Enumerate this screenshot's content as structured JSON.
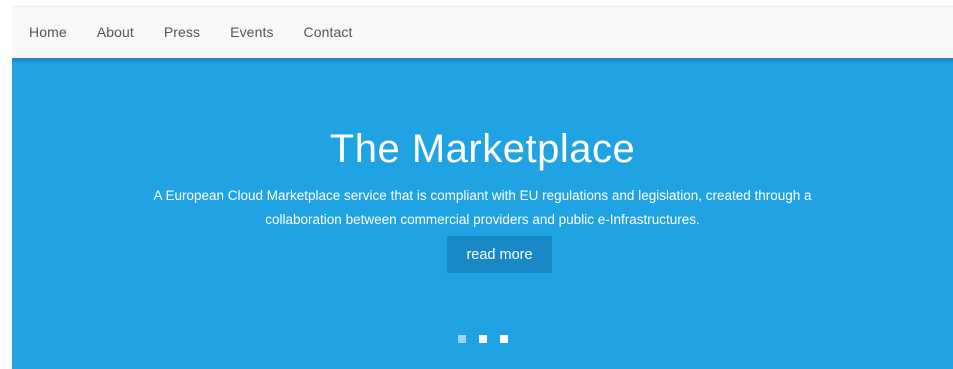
{
  "nav": {
    "items": [
      {
        "label": "Home"
      },
      {
        "label": "About"
      },
      {
        "label": "Press"
      },
      {
        "label": "Events"
      },
      {
        "label": "Contact"
      }
    ]
  },
  "hero": {
    "title": "The Marketplace",
    "description": "A European Cloud Marketplace service that is compliant with EU regulations and legislation, created through a collaboration between commercial providers and public e-Infrastructures.",
    "button_label": "read more",
    "slides_count": 3,
    "active_slide_index": 1
  },
  "colors": {
    "hero_background": "#1fa3e2",
    "hero_border": "#1b8ccc",
    "button_background": "#1889c6",
    "navbar_background": "#f8f8f8",
    "nav_text": "#555555"
  }
}
